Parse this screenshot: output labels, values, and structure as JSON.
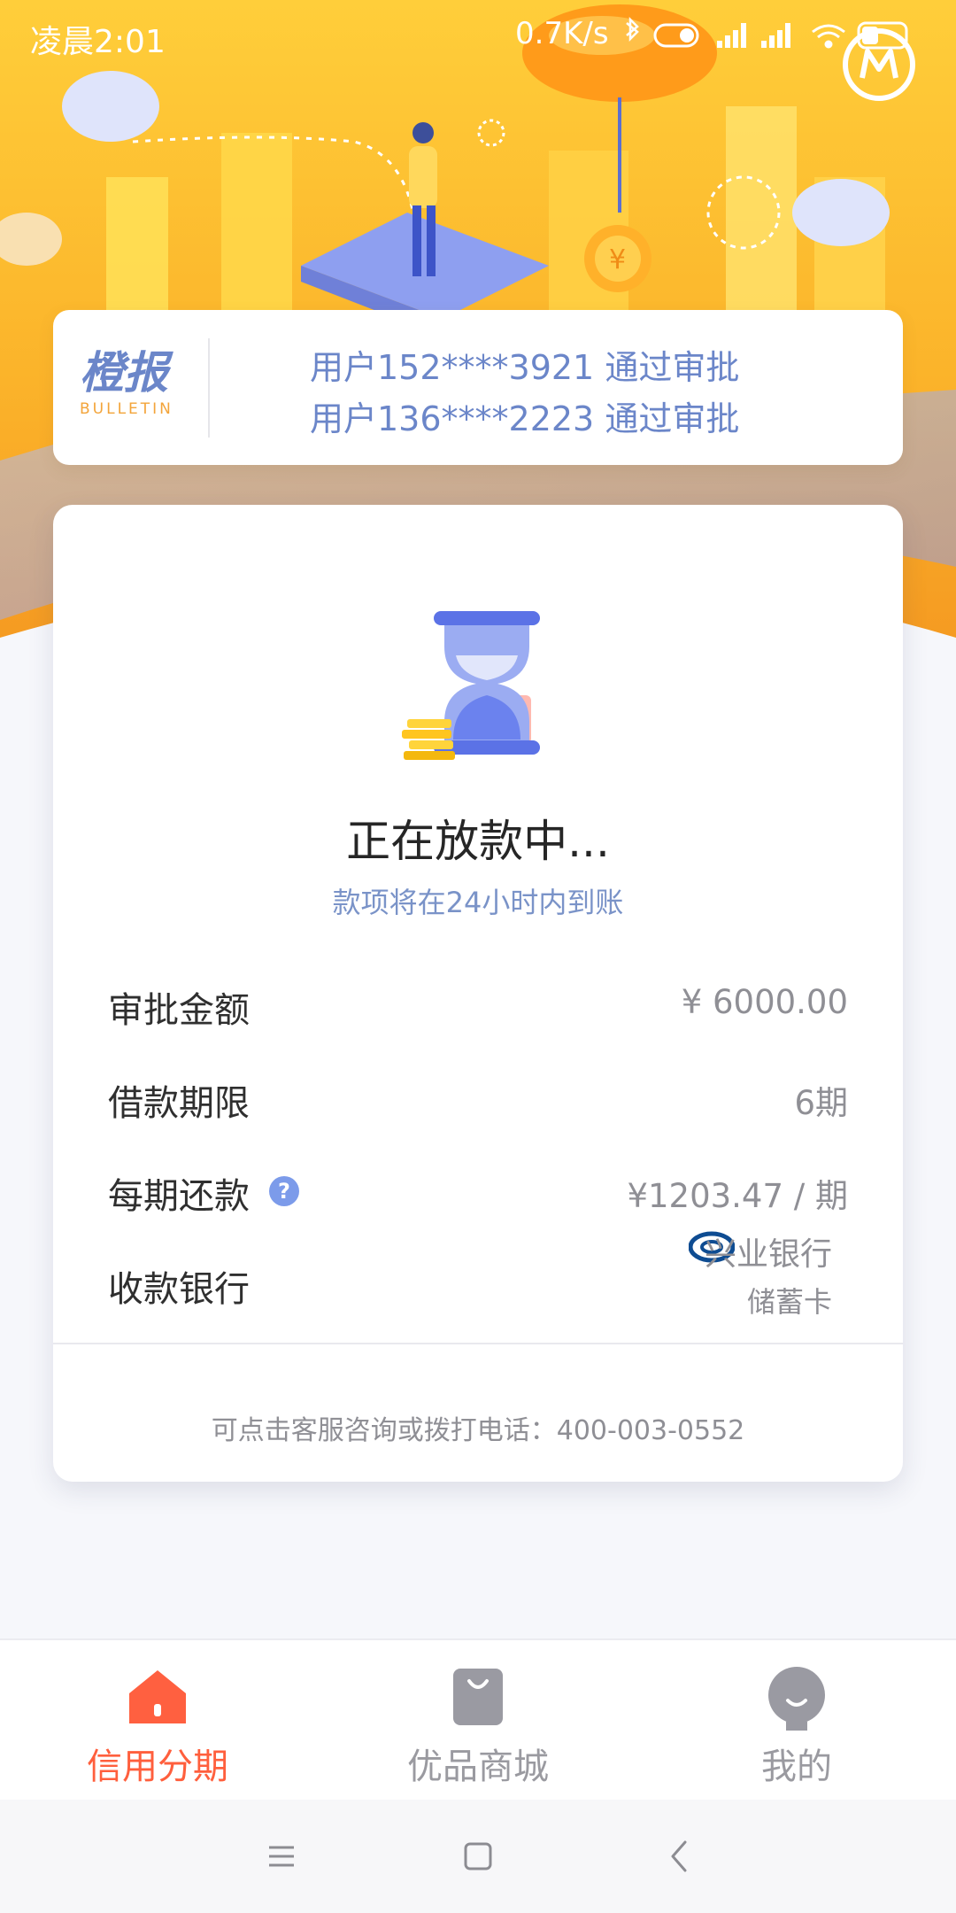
{
  "status_bar": {
    "time": "凌晨2:01",
    "net_speed": "0.7K/s",
    "battery": "33"
  },
  "bulletin": {
    "logo_main": "橙报",
    "logo_sub": "BULLETIN",
    "messages": [
      "用户152****3921 通过审批",
      "用户136****2223 通过审批"
    ]
  },
  "loan": {
    "status_title": "正在放款中...",
    "status_subtitle": "款项将在24小时内到账",
    "rows": {
      "amount": {
        "label": "审批金额",
        "value": "¥ 6000.00"
      },
      "term": {
        "label": "借款期限",
        "value": "6期"
      },
      "installment": {
        "label": "每期还款",
        "value": "¥1203.47 / 期",
        "help_icon": "question-icon"
      },
      "bank": {
        "label": "收款银行",
        "bank_name": "兴业银行",
        "card_type": "储蓄卡"
      }
    },
    "support_text": "可点击客服咨询或拨打电话：400-003-0552"
  },
  "tabs": [
    {
      "label": "信用分期",
      "icon": "home-icon",
      "active": true
    },
    {
      "label": "优品商城",
      "icon": "shopping-bag-icon",
      "active": false
    },
    {
      "label": "我的",
      "icon": "profile-icon",
      "active": false
    }
  ],
  "colors": {
    "accent": "#ff5f3d",
    "hero_orange": "#f9a825",
    "link_blue": "#6b86c9"
  }
}
